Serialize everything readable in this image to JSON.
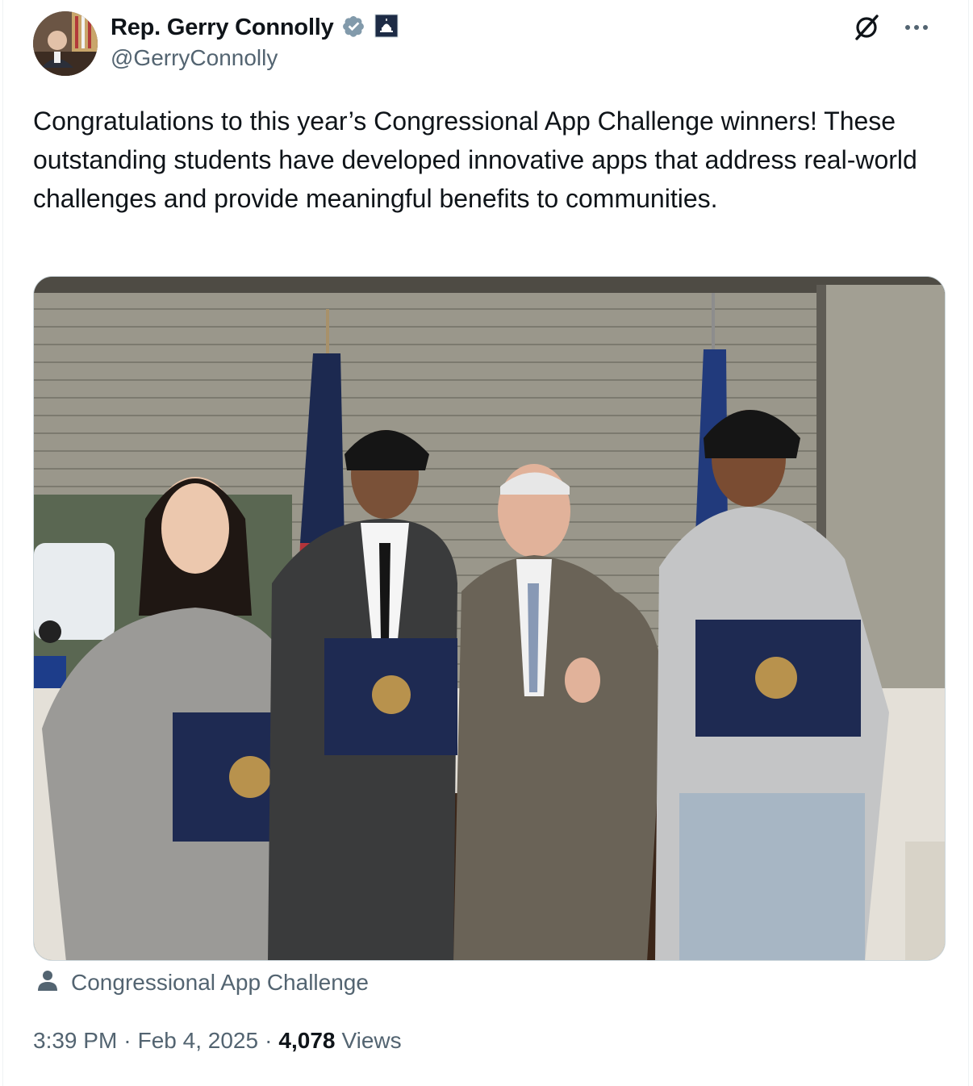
{
  "author": {
    "display_name": "Rep. Gerry Connolly",
    "handle": "@GerryConnolly",
    "verified_icon": "verified-badge-icon",
    "affiliation_icon": "capitol-badge-icon"
  },
  "actions": {
    "grok_icon": "grok-icon",
    "more_icon": "more-icon"
  },
  "tweet": {
    "text": "Congratulations to this year’s Congressional App Challenge winners! These outstanding students have developed innovative apps that address real-world challenges and provide meaningful benefits to communities."
  },
  "media": {
    "tagged_account": "Congressional App Challenge",
    "tag_icon": "person-icon"
  },
  "meta": {
    "time": "3:39 PM",
    "separator": "·",
    "date": "Feb 4, 2025",
    "views_count": "4,078",
    "views_label": "Views"
  },
  "colors": {
    "primary_text": "#0f1419",
    "secondary_text": "#536471",
    "verified": "#829aab",
    "border": "#cfd9de"
  }
}
